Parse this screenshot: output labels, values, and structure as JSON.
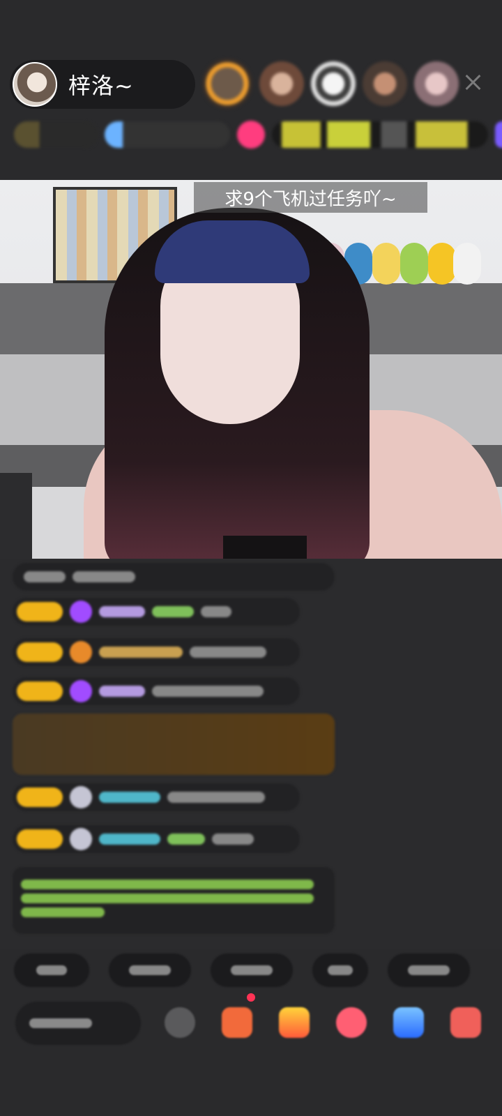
{
  "header": {
    "host_name": "梓洛~"
  },
  "video": {
    "caption": "求9个飞机过任务吖~"
  },
  "icons": [
    "close-icon"
  ]
}
